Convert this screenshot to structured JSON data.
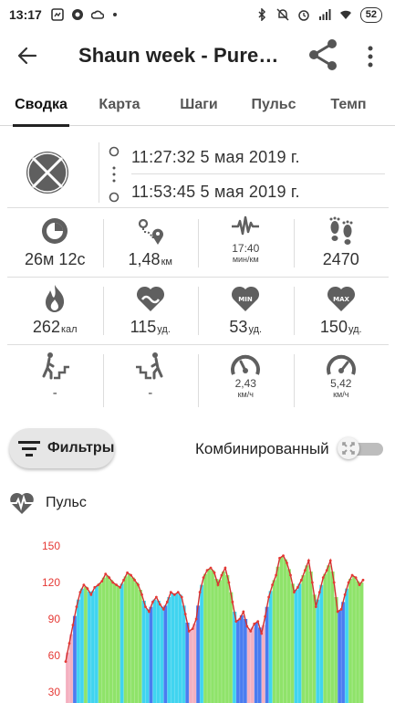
{
  "status_bar": {
    "time": "13:17",
    "battery": "52",
    "left_icons": [
      "screenshot-icon",
      "camera-icon",
      "cloud-icon",
      "dot-icon"
    ],
    "right_icons": [
      "bluetooth-icon",
      "mute-icon",
      "alarm-icon",
      "signal-icon",
      "wifi-icon"
    ]
  },
  "app_bar": {
    "title": "Shaun week - Pure…",
    "back_icon": "arrow-back-icon",
    "share_icon": "share-icon",
    "more_icon": "more-vert-icon"
  },
  "tabs": [
    {
      "label": "Сводка",
      "active": true
    },
    {
      "label": "Карта",
      "active": false
    },
    {
      "label": "Шаги",
      "active": false
    },
    {
      "label": "Пульс",
      "active": false
    },
    {
      "label": "Темп",
      "active": false
    }
  ],
  "session": {
    "start": "11:27:32 5 мая 2019 г.",
    "end": "11:53:45 5 мая 2019 г.",
    "sport_icon": "sport-ball-icon"
  },
  "stats": {
    "row1": [
      {
        "icon": "duration-icon",
        "value": "26м 12с"
      },
      {
        "icon": "distance-icon",
        "value": "1,48",
        "unit": "км"
      },
      {
        "icon": "pace-icon",
        "value": "17:40",
        "unit": "мин/км"
      },
      {
        "icon": "steps-icon",
        "value": "2470"
      }
    ],
    "row2": [
      {
        "icon": "calories-icon",
        "value": "262",
        "unit": "кал"
      },
      {
        "icon": "avg-heart-icon",
        "value": "115",
        "unit": "уд."
      },
      {
        "icon": "min-heart-icon",
        "value": "53",
        "unit": "уд.",
        "badge": "MIN"
      },
      {
        "icon": "max-heart-icon",
        "value": "150",
        "unit": "уд.",
        "badge": "MAX"
      }
    ],
    "row3": [
      {
        "icon": "ascent-icon",
        "value": "-"
      },
      {
        "icon": "descent-icon",
        "value": "-"
      },
      {
        "icon": "avg-speed-icon",
        "value": "2,43",
        "unit": "км/ч"
      },
      {
        "icon": "max-speed-icon",
        "value": "5,42",
        "unit": "км/ч"
      }
    ]
  },
  "filters": {
    "button_label": "Фильтры",
    "combined_label": "Комбинированный",
    "combined_on": false
  },
  "pulse_section": {
    "title": "Пульс",
    "icon": "heart-pulse-icon"
  },
  "colors": {
    "accent_red": "#e53935",
    "line_red": "#d32f2f",
    "zone_blue": "#4a7cf0",
    "zone_cyan": "#40d4f0",
    "zone_green": "#8fe36a",
    "zone_pink": "#f4b0c0",
    "icon_gray": "#5f5f5f"
  },
  "chart_data": {
    "type": "area",
    "title": "Пульс",
    "xlabel": "",
    "ylabel": "",
    "ylim": [
      0,
      160
    ],
    "yticks": [
      30,
      60,
      90,
      120,
      150
    ],
    "grid": false,
    "series": [
      {
        "values": [
          55,
          70,
          85,
          100,
          112,
          118,
          115,
          110,
          116,
          118,
          121,
          127,
          124,
          120,
          118,
          116,
          122,
          128,
          126,
          122,
          118,
          110,
          100,
          96,
          104,
          108,
          102,
          98,
          104,
          112,
          110,
          112,
          108,
          94,
          80,
          82,
          90,
          112,
          124,
          130,
          132,
          128,
          118,
          126,
          132,
          120,
          104,
          88,
          90,
          96,
          84,
          80,
          86,
          88,
          78,
          92,
          108,
          118,
          126,
          140,
          142,
          136,
          126,
          112,
          116,
          122,
          130,
          138,
          120,
          100,
          112,
          124,
          130,
          138,
          120,
          96,
          98,
          110,
          120,
          126,
          124,
          118,
          122
        ]
      }
    ]
  }
}
